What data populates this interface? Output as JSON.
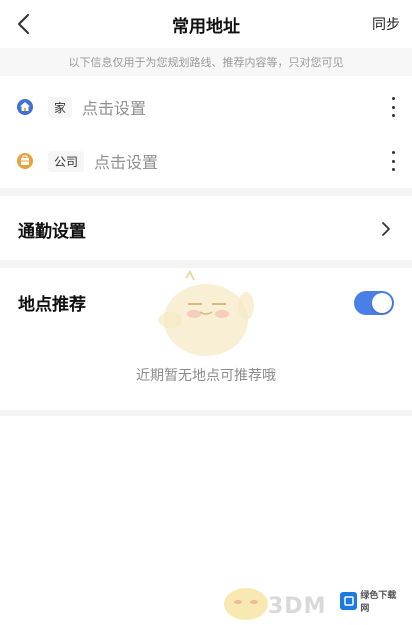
{
  "header": {
    "title": "常用地址",
    "sync_label": "同步"
  },
  "notice": "以下信息仅用于为您规划路线、推荐内容等，只对您可见",
  "addresses": [
    {
      "tag": "家",
      "value": "点击设置",
      "icon": "home-icon"
    },
    {
      "tag": "公司",
      "value": "点击设置",
      "icon": "company-icon"
    }
  ],
  "commute": {
    "label": "通勤设置"
  },
  "recommend": {
    "label": "地点推荐",
    "toggle_on": true,
    "empty_text": "近期暂无地点可推荐哦"
  },
  "watermark": {
    "text": "3DM",
    "logo_text": "绿色下载网"
  },
  "colors": {
    "accent": "#4a7fe6",
    "home_icon": "#3f6fd8",
    "company_icon": "#e6a23c"
  }
}
